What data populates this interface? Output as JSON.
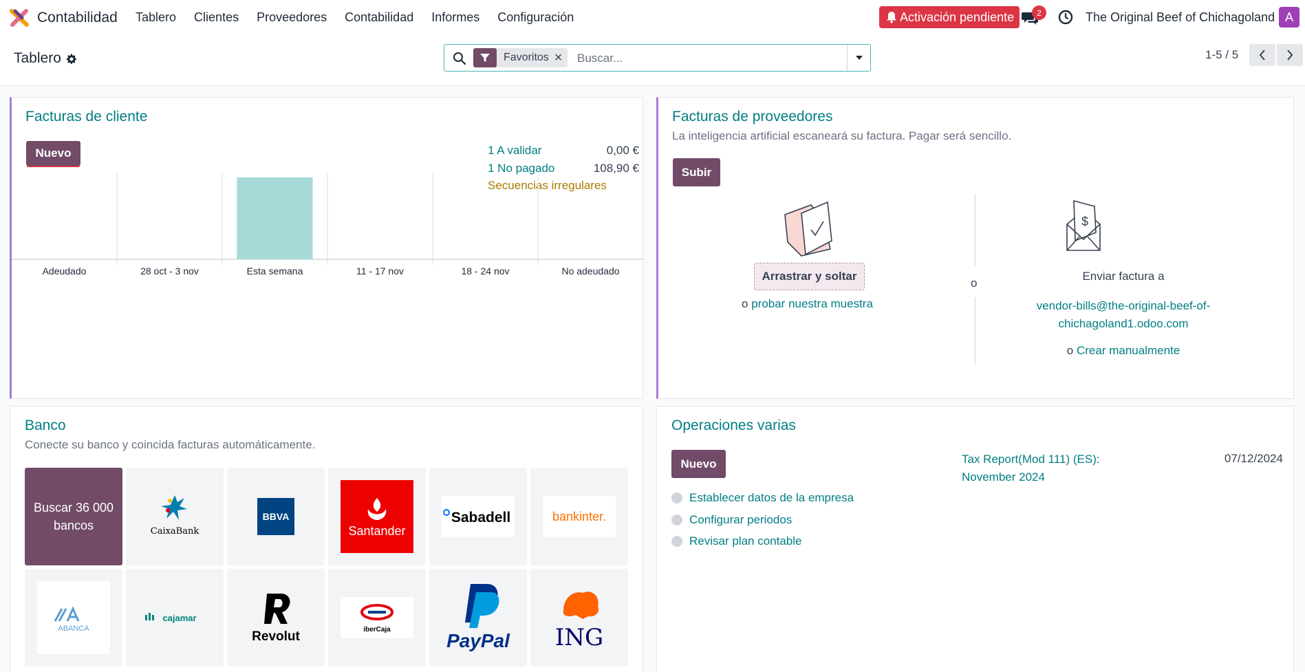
{
  "navbar": {
    "app_name": "Contabilidad",
    "menu": [
      "Tablero",
      "Clientes",
      "Proveedores",
      "Contabilidad",
      "Informes",
      "Configuración"
    ],
    "activation_label": "Activación pendiente",
    "chat_count": "2",
    "company": "The Original Beef of Chichagoland",
    "avatar_letter": "A"
  },
  "control_panel": {
    "breadcrumb": "Tablero",
    "facet_label": "Favoritos",
    "search_placeholder": "Buscar...",
    "pager": "1-5 / 5"
  },
  "customer_invoices": {
    "title": "Facturas de cliente",
    "new_label": "Nuevo",
    "stats": [
      {
        "label": "1 A validar",
        "value": "0,00 €"
      },
      {
        "label": "1 No pagado",
        "value": "108,90 €"
      }
    ],
    "warning_label": "Secuencias irregulares"
  },
  "chart_data": {
    "type": "bar",
    "categories": [
      "Adeudado",
      "28 oct - 3 nov",
      "Esta semana",
      "11 - 17 nov",
      "18 - 24 nov",
      "No adeudado"
    ],
    "values": [
      0,
      0,
      108.9,
      0,
      0,
      0
    ],
    "bar_color": "#a7dad9",
    "grid": true
  },
  "vendor_bills": {
    "title": "Facturas de proveedores",
    "subtitle": "La inteligencia artificial escaneará su factura. Pagar será sencillo.",
    "upload_label": "Subir",
    "drag_label": "Arrastrar y soltar",
    "or_label": "o",
    "sample_link": "probar nuestra muestra",
    "send_label": "Enviar factura a",
    "email_line1": "vendor-bills@the-original-beef-of-",
    "email_line2": "chichagoland1.odoo.com",
    "manual_link": "Crear manualmente"
  },
  "bank": {
    "title": "Banco",
    "subtitle": "Conecte su banco y coincida facturas automáticamente.",
    "search_tile": "Buscar 36 000 bancos",
    "banks": [
      "CaixaBank",
      "BBVA",
      "Santander",
      "Sabadell",
      "bankinter.",
      "ABANCA",
      "cajamar",
      "Revolut",
      "iberCaja",
      "PayPal",
      "ING"
    ]
  },
  "misc_operations": {
    "title": "Operaciones varias",
    "new_label": "Nuevo",
    "report_line1": "Tax Report(Mod 111) (ES):",
    "report_line2": "November 2024",
    "report_date": "07/12/2024",
    "steps": [
      "Establecer datos de la empresa",
      "Configurar periodos",
      "Revisar plan contable"
    ]
  },
  "colors": {
    "brand": "#714b67",
    "link": "#017e84",
    "danger": "#dc3545",
    "favorite_border": "#a57cd6"
  }
}
